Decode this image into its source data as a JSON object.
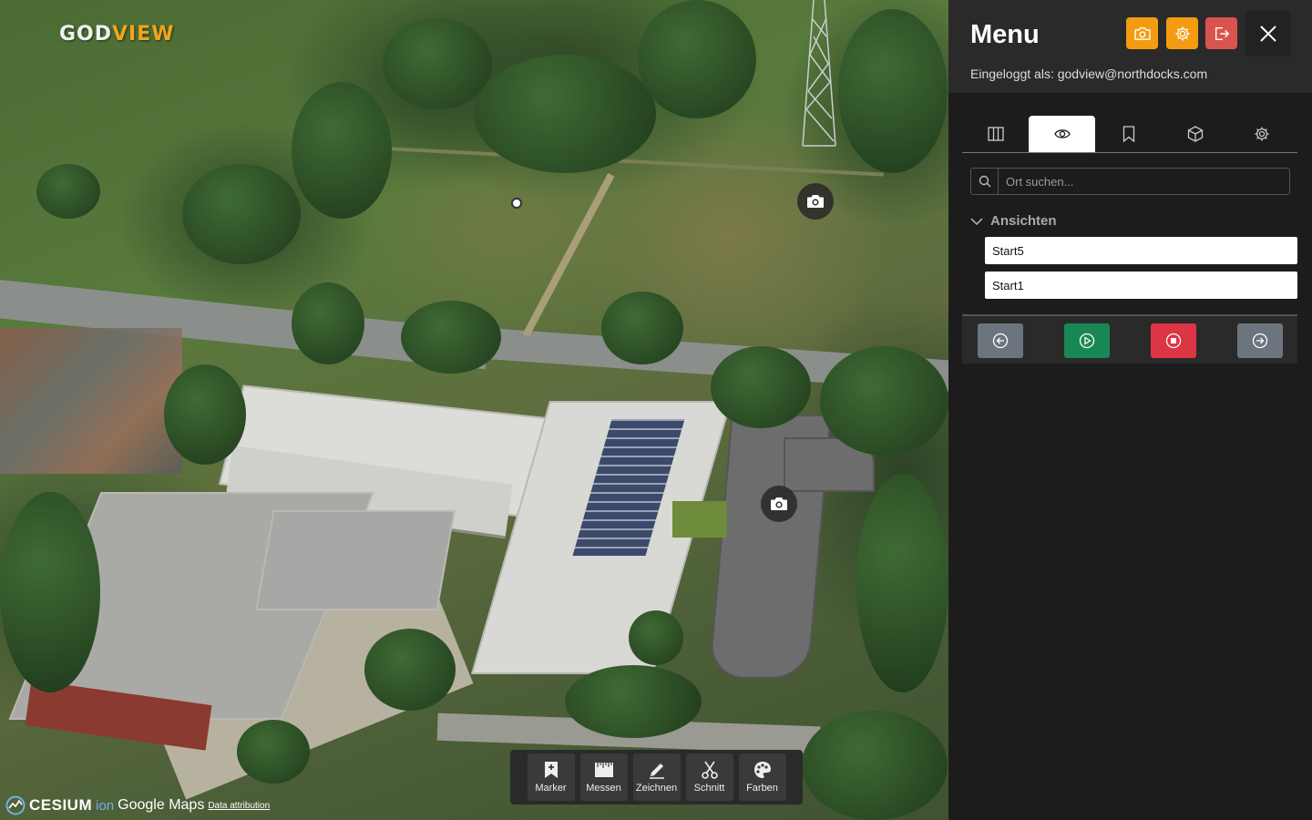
{
  "app": {
    "logo_text": "GOD",
    "logo_accent": "VIEW"
  },
  "map": {
    "markers": [
      {
        "icon": "camera-icon"
      },
      {
        "icon": "camera-icon"
      },
      {
        "icon": "point-marker"
      }
    ]
  },
  "toolbar": {
    "items": [
      {
        "label": "Marker",
        "icon": "bookmark-plus-icon"
      },
      {
        "label": "Messen",
        "icon": "ruler-icon"
      },
      {
        "label": "Zeichnen",
        "icon": "pencil-icon"
      },
      {
        "label": "Schnitt",
        "icon": "scissors-icon"
      },
      {
        "label": "Farben",
        "icon": "palette-icon"
      }
    ]
  },
  "credits": {
    "cesium": "CESIUM",
    "ion": "ion",
    "google": "Google Maps",
    "attribution": "Data attribution"
  },
  "panel": {
    "title": "Menu",
    "logged_in": "Eingeloggt als: godview@northdocks.com",
    "header_buttons": [
      {
        "icon": "camera-icon",
        "color": "#f39c12"
      },
      {
        "icon": "gear-icon",
        "color": "#f39c12"
      },
      {
        "icon": "logout-icon",
        "color": "#d9534f"
      },
      {
        "icon": "close-icon"
      }
    ],
    "tabs": [
      {
        "icon": "columns-icon",
        "active": false
      },
      {
        "icon": "eye-icon",
        "active": true
      },
      {
        "icon": "bookmark-icon",
        "active": false
      },
      {
        "icon": "cube-icon",
        "active": false
      },
      {
        "icon": "gear-icon",
        "active": false
      }
    ],
    "search": {
      "placeholder": "Ort suchen...",
      "value": ""
    },
    "views": {
      "header": "Ansichten",
      "items": [
        "Start5",
        "Start1"
      ]
    },
    "controls": [
      {
        "icon": "arrow-left-circle-icon",
        "color": "#6c757d"
      },
      {
        "icon": "play-circle-icon",
        "color": "#198754"
      },
      {
        "icon": "stop-circle-icon",
        "color": "#dc3545"
      },
      {
        "icon": "arrow-right-circle-icon",
        "color": "#6c757d"
      }
    ]
  }
}
